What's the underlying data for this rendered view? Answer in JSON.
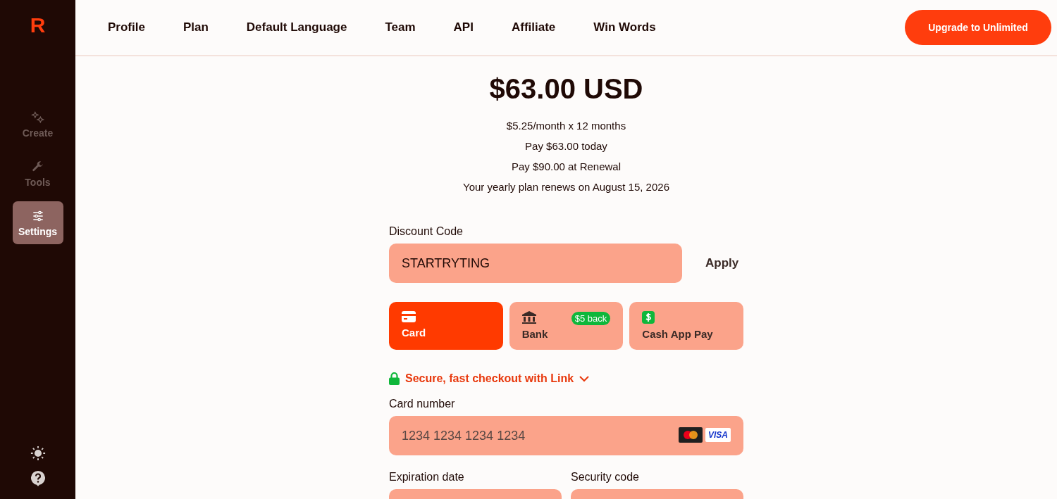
{
  "sidebar": {
    "logo": "R",
    "items": [
      {
        "label": "Create",
        "kind": "sparkles",
        "selected": false
      },
      {
        "label": "Tools",
        "kind": "wrench",
        "selected": false
      },
      {
        "label": "Settings",
        "kind": "sliders",
        "selected": true
      }
    ]
  },
  "nav": {
    "tabs": [
      "Profile",
      "Plan",
      "Default Language",
      "Team",
      "API",
      "Affiliate",
      "Win Words"
    ],
    "upgrade_button": "Upgrade to Unlimited"
  },
  "plan": {
    "price": "$63.00 USD",
    "lines": [
      "$5.25/month x 12 months",
      "Pay $63.00 today",
      "Pay $90.00 at Renewal",
      "Your yearly plan renews on August 15, 2026"
    ]
  },
  "discount": {
    "label": "Discount Code",
    "value": "STARTRYTING",
    "apply_button": "Apply"
  },
  "payment_methods": [
    {
      "kind": "card",
      "label": "Card",
      "selected": true
    },
    {
      "kind": "bank",
      "label": "Bank",
      "selected": false,
      "badge": "$5 back"
    },
    {
      "kind": "cashapp",
      "label": "Cash App Pay",
      "selected": false
    }
  ],
  "link_checkout": "Secure, fast checkout with Link",
  "card_number": {
    "label": "Card number",
    "placeholder": "1234 1234 1234 1234",
    "brand": "VISA"
  },
  "expiration": {
    "label": "Expiration date"
  },
  "security": {
    "label": "Security code"
  }
}
